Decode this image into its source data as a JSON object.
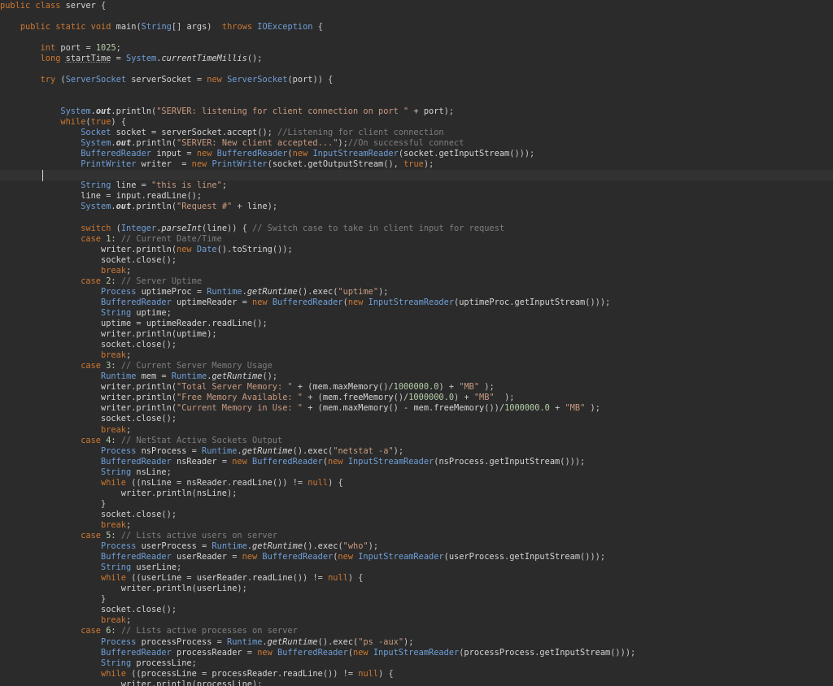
{
  "editor": {
    "language": "Java",
    "lines": [
      "public class server {",
      "",
      "    public static void main(String[] args)  throws IOException {",
      "",
      "        int port = 1025;",
      "        long startTime = System.currentTimeMillis();",
      "",
      "        try (ServerSocket serverSocket = new ServerSocket(port)) {",
      "",
      "",
      "            System.out.println(\"SERVER: listening for client connection on port \" + port);",
      "            while(true) {",
      "                Socket socket = serverSocket.accept(); //Listening for client connection",
      "                System.out.println(\"SERVER: New client accepted...\");//On successful connect",
      "                BufferedReader input = new BufferedReader(new InputStreamReader(socket.getInputStream()));",
      "                PrintWriter writer  = new PrintWriter(socket.getOutputStream(), true);",
      "",
      "                String line = \"this is line\";",
      "                line = input.readLine();",
      "                System.out.println(\"Request #\" + line);",
      "",
      "                switch (Integer.parseInt(line)) { // Switch case to take in client input for request",
      "                case 1: // Current Date/Time",
      "                    writer.println(new Date().toString());",
      "                    socket.close();",
      "                    break;",
      "                case 2: // Server Uptime",
      "                    Process uptimeProc = Runtime.getRuntime().exec(\"uptime\");",
      "                    BufferedReader uptimeReader = new BufferedReader(new InputStreamReader(uptimeProc.getInputStream()));",
      "                    String uptime;",
      "                    uptime = uptimeReader.readLine();",
      "                    writer.println(uptime);",
      "                    socket.close();",
      "                    break;",
      "                case 3: // Current Server Memory Usage",
      "                    Runtime mem = Runtime.getRuntime();",
      "                    writer.println(\"Total Server Memory: \" + (mem.maxMemory()/1000000.0) + \"MB\" );",
      "                    writer.println(\"Free Memory Available: \" + (mem.freeMemory()/1000000.0) + \"MB\"  );",
      "                    writer.println(\"Current Memory in Use: \" + (mem.maxMemory() - mem.freeMemory())/1000000.0 + \"MB\" );",
      "                    socket.close();",
      "                    break;",
      "                case 4: // NetStat Active Sockets Output",
      "                    Process nsProcess = Runtime.getRuntime().exec(\"netstat -a\");",
      "                    BufferedReader nsReader = new BufferedReader(new InputStreamReader(nsProcess.getInputStream()));",
      "                    String nsLine;",
      "                    while ((nsLine = nsReader.readLine()) != null) {",
      "                        writer.println(nsLine);",
      "                    }",
      "                    socket.close();",
      "                    break;",
      "                case 5: // Lists active users on server",
      "                    Process userProcess = Runtime.getRuntime().exec(\"who\");",
      "                    BufferedReader userReader = new BufferedReader(new InputStreamReader(userProcess.getInputStream()));",
      "                    String userLine;",
      "                    while ((userLine = userReader.readLine()) != null) {",
      "                        writer.println(userLine);",
      "                    }",
      "                    socket.close();",
      "                    break;",
      "                case 6: // Lists active processes on server",
      "                    Process processProcess = Runtime.getRuntime().exec(\"ps -aux\");",
      "                    BufferedReader processReader = new BufferedReader(new InputStreamReader(processProcess.getInputStream()));",
      "                    String processLine;",
      "                    while ((processLine = processReader.readLine()) != null) {",
      "                        writer.println(processLine);"
    ],
    "current_line_index": 16,
    "colors": {
      "background": "#2b2b2b",
      "current_line": "#323232",
      "keyword": "#cc7832",
      "type": "#6f9fd8",
      "string": "#c99a80",
      "comment": "#7e7e7e",
      "number": "#b5cea8",
      "identifier": "#d4d4d4"
    }
  }
}
